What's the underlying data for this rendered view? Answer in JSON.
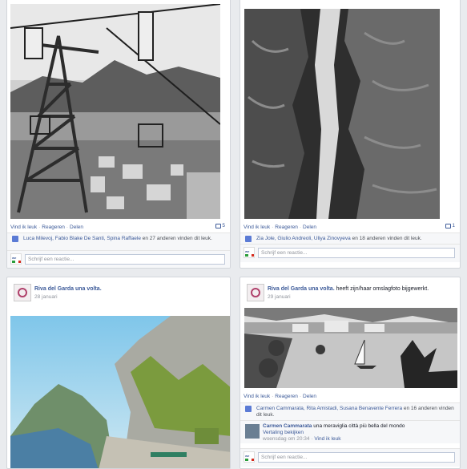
{
  "posts": [
    {
      "actions": {
        "like": "Vind ik leuk",
        "comment": "Reageren",
        "share": "Delen"
      },
      "comment_count": "5",
      "likes_names": "Luca Milevoj, Fabio Blake De Santi, Spina Raffaele",
      "likes_suffix": " en 27 anderen vinden dit leuk.",
      "comment_placeholder": "Schrijf een reactie..."
    },
    {
      "actions": {
        "like": "Vind ik leuk",
        "comment": "Reageren",
        "share": "Delen"
      },
      "comment_count": "1",
      "likes_names": "Zia Jole, Giulio Andreoli, Uliya Zinovyeva",
      "likes_suffix": " en 18 anderen vinden dit leuk.",
      "comment_placeholder": "Schrijf een reactie..."
    },
    {
      "page_name": "Riva del Garda una volta.",
      "date": "28 januari"
    },
    {
      "page_name": "Riva del Garda una volta.",
      "page_action": " heeft zijn/haar omslagfoto bijgewerkt.",
      "date": "29 januari",
      "actions": {
        "like": "Vind ik leuk",
        "comment": "Reageren",
        "share": "Delen"
      },
      "likes_names": "Carmen Cammarata, Rita Amistadi, Susana Benavente Ferrera",
      "likes_suffix": " en 16 anderen vinden dit leuk.",
      "reply": {
        "author": "Carmen Cammarata",
        "text": " una meraviglia città più bella del mondo",
        "translate": "Vertaling bekijken",
        "meta": "woensdag om 20:34 · ",
        "like": "Vind ik leuk"
      },
      "comment_placeholder": "Schrijf een reactie..."
    }
  ],
  "icons": {
    "like": "thumbs-up-icon",
    "comment": "comment-bubble-icon"
  }
}
